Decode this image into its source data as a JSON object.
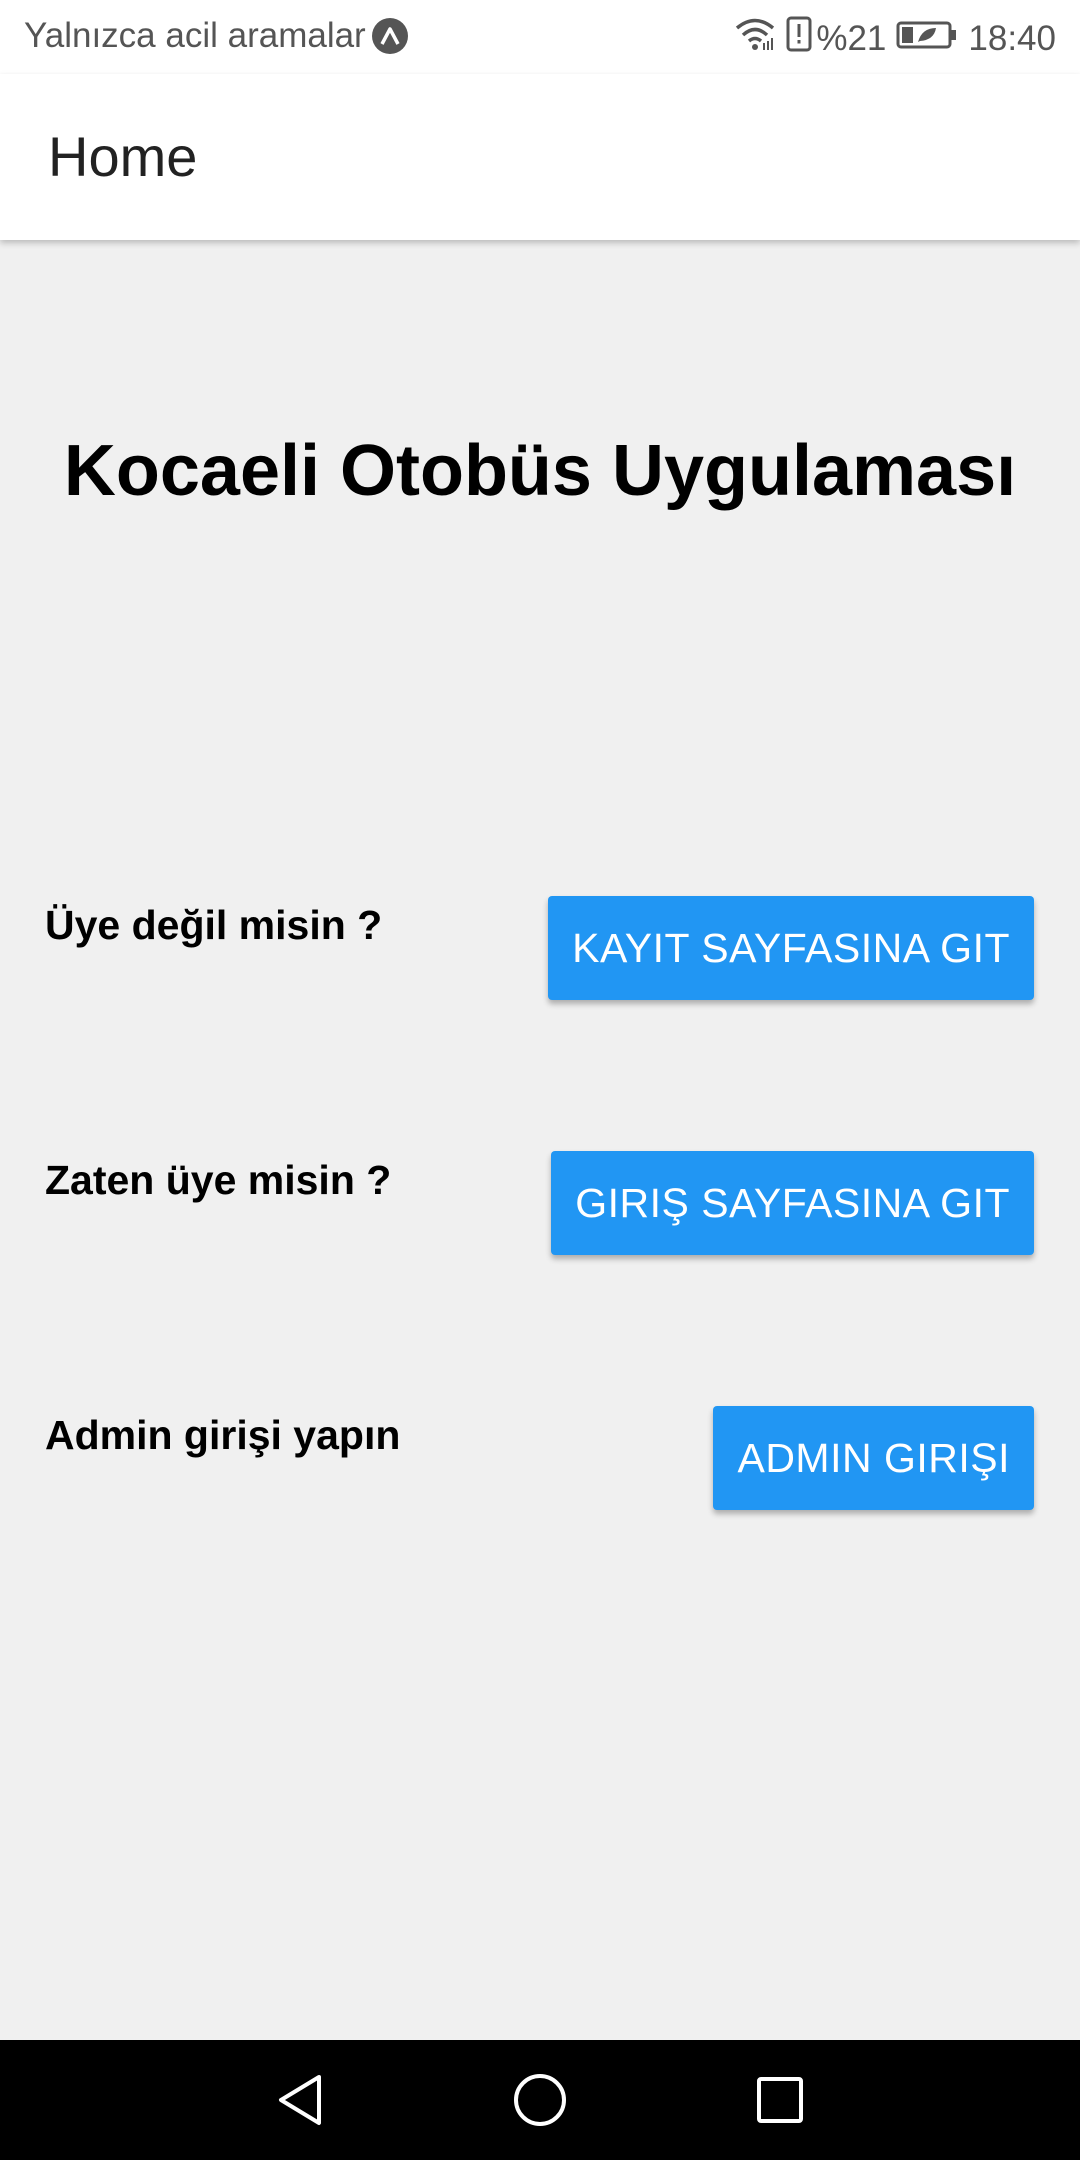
{
  "status_bar": {
    "carrier_text": "Yalnızca acil aramalar",
    "battery_percent": "%21",
    "time": "18:40",
    "icons": [
      "app-notification-icon",
      "wifi-icon",
      "alert-icon",
      "battery-icon"
    ]
  },
  "app_bar": {
    "title": "Home"
  },
  "main": {
    "title": "Kocaeli Otobüs Uygulaması",
    "rows": [
      {
        "label": "Üye değil misin ?",
        "button": "KAYIT SAYFASINA GIT"
      },
      {
        "label": "Zaten üye misin ?",
        "button": "GIRIŞ SAYFASINA GIT"
      },
      {
        "label": "Admin girişi yapın",
        "button": "ADMIN GIRIŞI"
      }
    ]
  },
  "colors": {
    "button": "#2196f3",
    "background": "#f0f0f0",
    "app_bar": "#ffffff",
    "nav_bar": "#000000"
  },
  "nav_bar": {
    "icons": [
      "back-icon",
      "home-icon",
      "recents-icon"
    ]
  }
}
